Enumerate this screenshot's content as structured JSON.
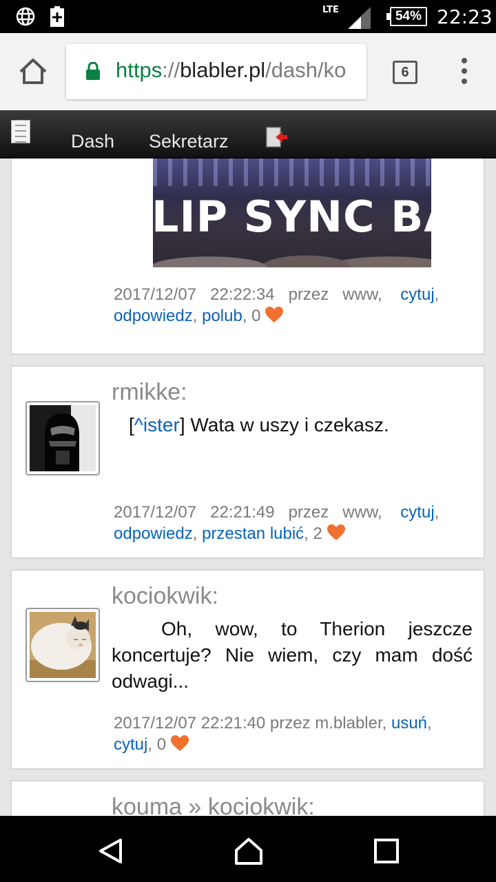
{
  "status_bar": {
    "network": "LTE",
    "battery": "54%",
    "time": "22:23",
    "icons": [
      "globe-icon",
      "battery-saver-plus-icon",
      "signal-icon",
      "battery-icon"
    ]
  },
  "browser": {
    "url_scheme": "https",
    "url_sep": "://",
    "url_host": "blabler.pl",
    "url_path": "/dash/ko",
    "tab_count": "6",
    "icons": [
      "home-icon",
      "lock-icon",
      "tabs-icon",
      "overflow-menu-icon"
    ]
  },
  "site_nav": {
    "items": [
      {
        "label": "Dash"
      },
      {
        "label": "Sekretarz"
      }
    ],
    "icons": [
      "document-icon",
      "logout-icon"
    ]
  },
  "posts": [
    {
      "image_text": "LIP SYNC BAT",
      "date": "2017/12/07",
      "time": "22:22:34",
      "by": "przez",
      "source": "www,",
      "action1": "cytuj",
      "action2": "odpowiedz",
      "action3": "polub",
      "likes": "0"
    },
    {
      "author": "rmikke:",
      "quote_link": "^ister",
      "text": " Wata w uszy i czekasz.",
      "date": "2017/12/07",
      "time": "22:21:49",
      "by": "przez",
      "source": "www,",
      "action1": "cytuj",
      "action2": "odpowiedz",
      "action3": "przestan lubić",
      "likes": "2"
    },
    {
      "author": "kociokwik:",
      "text": "Oh, wow, to Therion jeszcze koncertuje? Nie wiem, czy mam dość odwagi...",
      "date": "2017/12/07",
      "time": "22:21:40",
      "by": "przez",
      "source": "m.blabler,",
      "action1": "usuń",
      "action2": "cytuj",
      "likes": "0"
    },
    {
      "author": "kouma » kociokwik:"
    }
  ],
  "colors": {
    "link": "#0a63b8",
    "heart": "#f07030",
    "secure": "#0b8043"
  },
  "system_nav": [
    "back-icon",
    "home-circle-icon",
    "recents-icon"
  ]
}
